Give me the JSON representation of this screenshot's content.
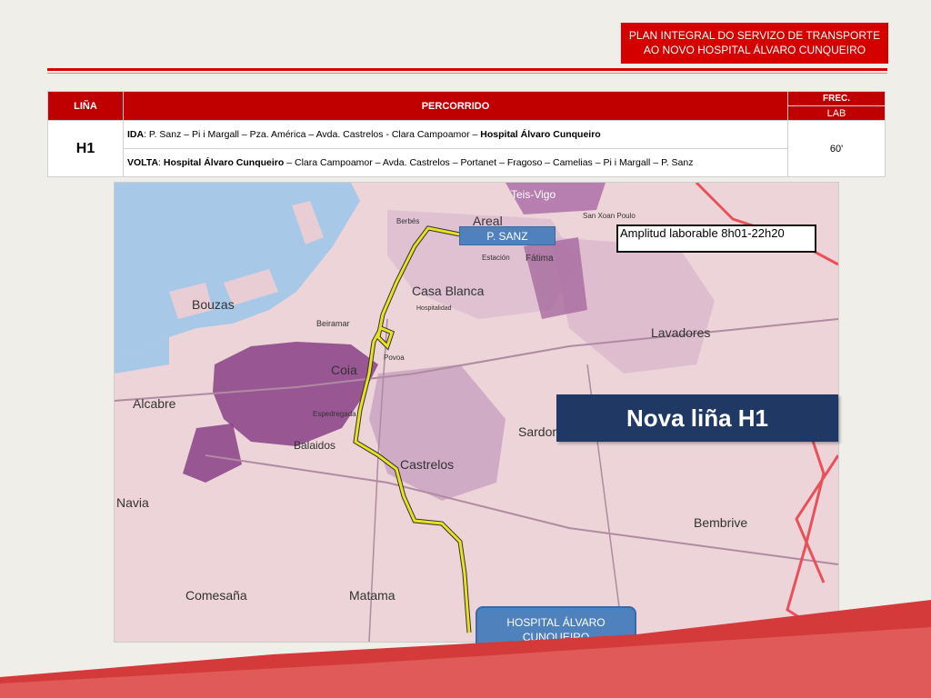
{
  "header": {
    "line1": "PLAN INTEGRAL DO SERVIZO  DE TRANSPORTE",
    "line2": "AO NOVO HOSPITAL ÁLVARO CUNQUEIRO"
  },
  "table": {
    "col_line": "LIÑA",
    "col_route": "PERCORRIDO",
    "col_freq": "FREC.",
    "col_freq_sub": "LAB",
    "row": {
      "line": "H1",
      "ida_label": "IDA",
      "ida_text": ": P. Sanz – Pi i Margall – Pza. América – Avda. Castrelos - Clara Campoamor – ",
      "ida_dest": "Hospital Álvaro Cunqueiro",
      "volta_label": "VOLTA",
      "volta_sep": ": ",
      "volta_origin": "Hospital Álvaro Cunqueiro",
      "volta_text": " – Clara Campoamor – Avda. Castrelos – Portanet – Fragoso – Camelias – Pi i Margall – P. Sanz",
      "freq": "60'"
    }
  },
  "map": {
    "labels": {
      "teis": "Teis-Vigo",
      "areal": "Areal",
      "bouzas": "Bouzas",
      "casa_blanca": "Casa Blanca",
      "lavadores": "Lavadores",
      "coia": "Coia",
      "alcabre": "Alcabre",
      "sardoma": "Sardoma",
      "balaidos": "Balaidos",
      "castrelos": "Castrelos",
      "navia": "Navia",
      "bembrive": "Bembrive",
      "comesana": "Comesaña",
      "matama": "Matama",
      "fatima": "Fátima",
      "beiramar": "Beiramar",
      "berbes": "Berbés",
      "estacion": "Estación",
      "hospital_small": "Hospitalidad",
      "espedregada": "Espedregada",
      "povoa": "Povoa",
      "san_xoan": "San Xoan Poulo"
    },
    "stop_origin": "P. SANZ",
    "stop_dest_line1": "HOSPITAL ÁLVARO",
    "stop_dest_line2": "CUNQUEIRO",
    "amplitud": "Amplitud laborable  8h01-22h20",
    "title": "Nova liña H1"
  },
  "colors": {
    "accent": "#d40000",
    "stop_blue": "#4f81bd",
    "title_navy": "#1f3864",
    "route_yellow": "#e8e020"
  }
}
